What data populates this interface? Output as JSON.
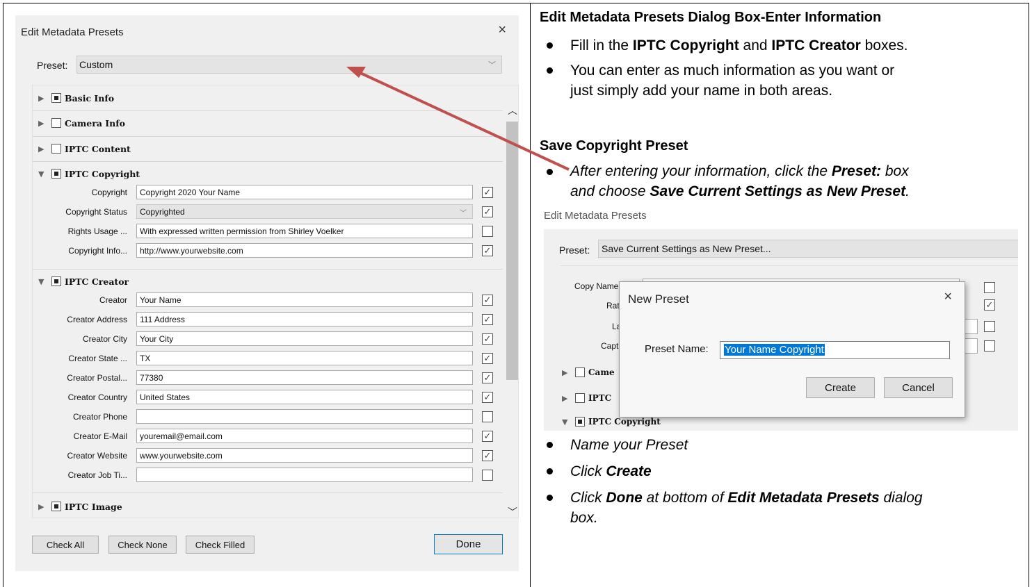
{
  "dialog": {
    "title": "Edit Metadata Presets",
    "close_glyph": "×",
    "preset_label": "Preset:",
    "preset_value": "Custom",
    "sections_top": [
      {
        "label": "Basic Info",
        "checked": "filled"
      },
      {
        "label": "Camera Info",
        "checked": "empty"
      },
      {
        "label": "IPTC Content",
        "checked": "empty"
      }
    ],
    "copyright": {
      "label": "IPTC Copyright",
      "rows": [
        {
          "label": "Copyright",
          "value": "Copyright 2020 Your Name",
          "check": "✓"
        },
        {
          "label": "Copyright Status",
          "value": "Copyrighted",
          "check": "✓"
        },
        {
          "label": "Rights Usage ...",
          "value": "With expressed written permission from Shirley Voelker",
          "check": ""
        },
        {
          "label": "Copyright Info...",
          "value": "http://www.yourwebsite.com",
          "check": "✓"
        }
      ]
    },
    "creator": {
      "label": "IPTC Creator",
      "rows": [
        {
          "label": "Creator",
          "value": "Your Name",
          "check": "✓"
        },
        {
          "label": "Creator Address",
          "value": "111 Address",
          "check": "✓"
        },
        {
          "label": "Creator City",
          "value": "Your City",
          "check": "✓"
        },
        {
          "label": "Creator State ...",
          "value": "TX",
          "check": "✓"
        },
        {
          "label": "Creator Postal...",
          "value": "77380",
          "check": "✓"
        },
        {
          "label": "Creator Country",
          "value": "United States",
          "check": "✓"
        },
        {
          "label": "Creator Phone",
          "value": "",
          "check": ""
        },
        {
          "label": "Creator E-Mail",
          "value": "youremail@email.com",
          "check": "✓"
        },
        {
          "label": "Creator Website",
          "value": "www.yourwebsite.com",
          "check": "✓"
        },
        {
          "label": "Creator Job Ti...",
          "value": "",
          "check": ""
        }
      ]
    },
    "image_section": "IPTC Image",
    "buttons": {
      "check_all": "Check All",
      "check_none": "Check None",
      "check_filled": "Check Filled",
      "done": "Done"
    }
  },
  "instructions": {
    "heading1": "Edit Metadata Presets Dialog Box-Enter Information",
    "b1_pre": "Fill in the ",
    "b1_bold1": "IPTC Copyright",
    "b1_mid": " and ",
    "b1_bold2": "IPTC Creator",
    "b1_post": " boxes.",
    "b2_line1": "You can enter as much information as you want or",
    "b2_line2": "just simply add your name in both areas.",
    "heading2": "Save Copyright Preset",
    "b3_pre": "After entering your information, click the ",
    "b3_bold1": "Preset:",
    "b3_mid": " box",
    "b3_line2_pre": "and choose ",
    "b3_bold2": "Save Current Settings as New Preset",
    "b3_line2_post": ".",
    "b4": "Name your Preset",
    "b5_pre": "Click ",
    "b5_bold": "Create",
    "b6_pre": "Click ",
    "b6_bold1": "Done",
    "b6_mid": " at bottom of ",
    "b6_bold2": "Edit Metadata Presets",
    "b6_post": " dialog",
    "b6_line2": "box."
  },
  "inset": {
    "title": "Edit Metadata Presets",
    "preset_label": "Preset:",
    "preset_value": "Save Current Settings as New Preset...",
    "labels": {
      "copy_name": "Copy Name",
      "ra": "Rat",
      "la": "La",
      "cap": "Capt",
      "cam": "Came",
      "iptc": "IPTC",
      "iptc_copyright": "IPTC Copyright"
    },
    "new_preset": {
      "title": "New Preset",
      "close_glyph": "×",
      "name_label": "Preset Name:",
      "name_value": "Your Name Copyright",
      "create": "Create",
      "cancel": "Cancel"
    }
  },
  "colors": {
    "arrow": "#c0504d",
    "accent": "#0078d7"
  }
}
